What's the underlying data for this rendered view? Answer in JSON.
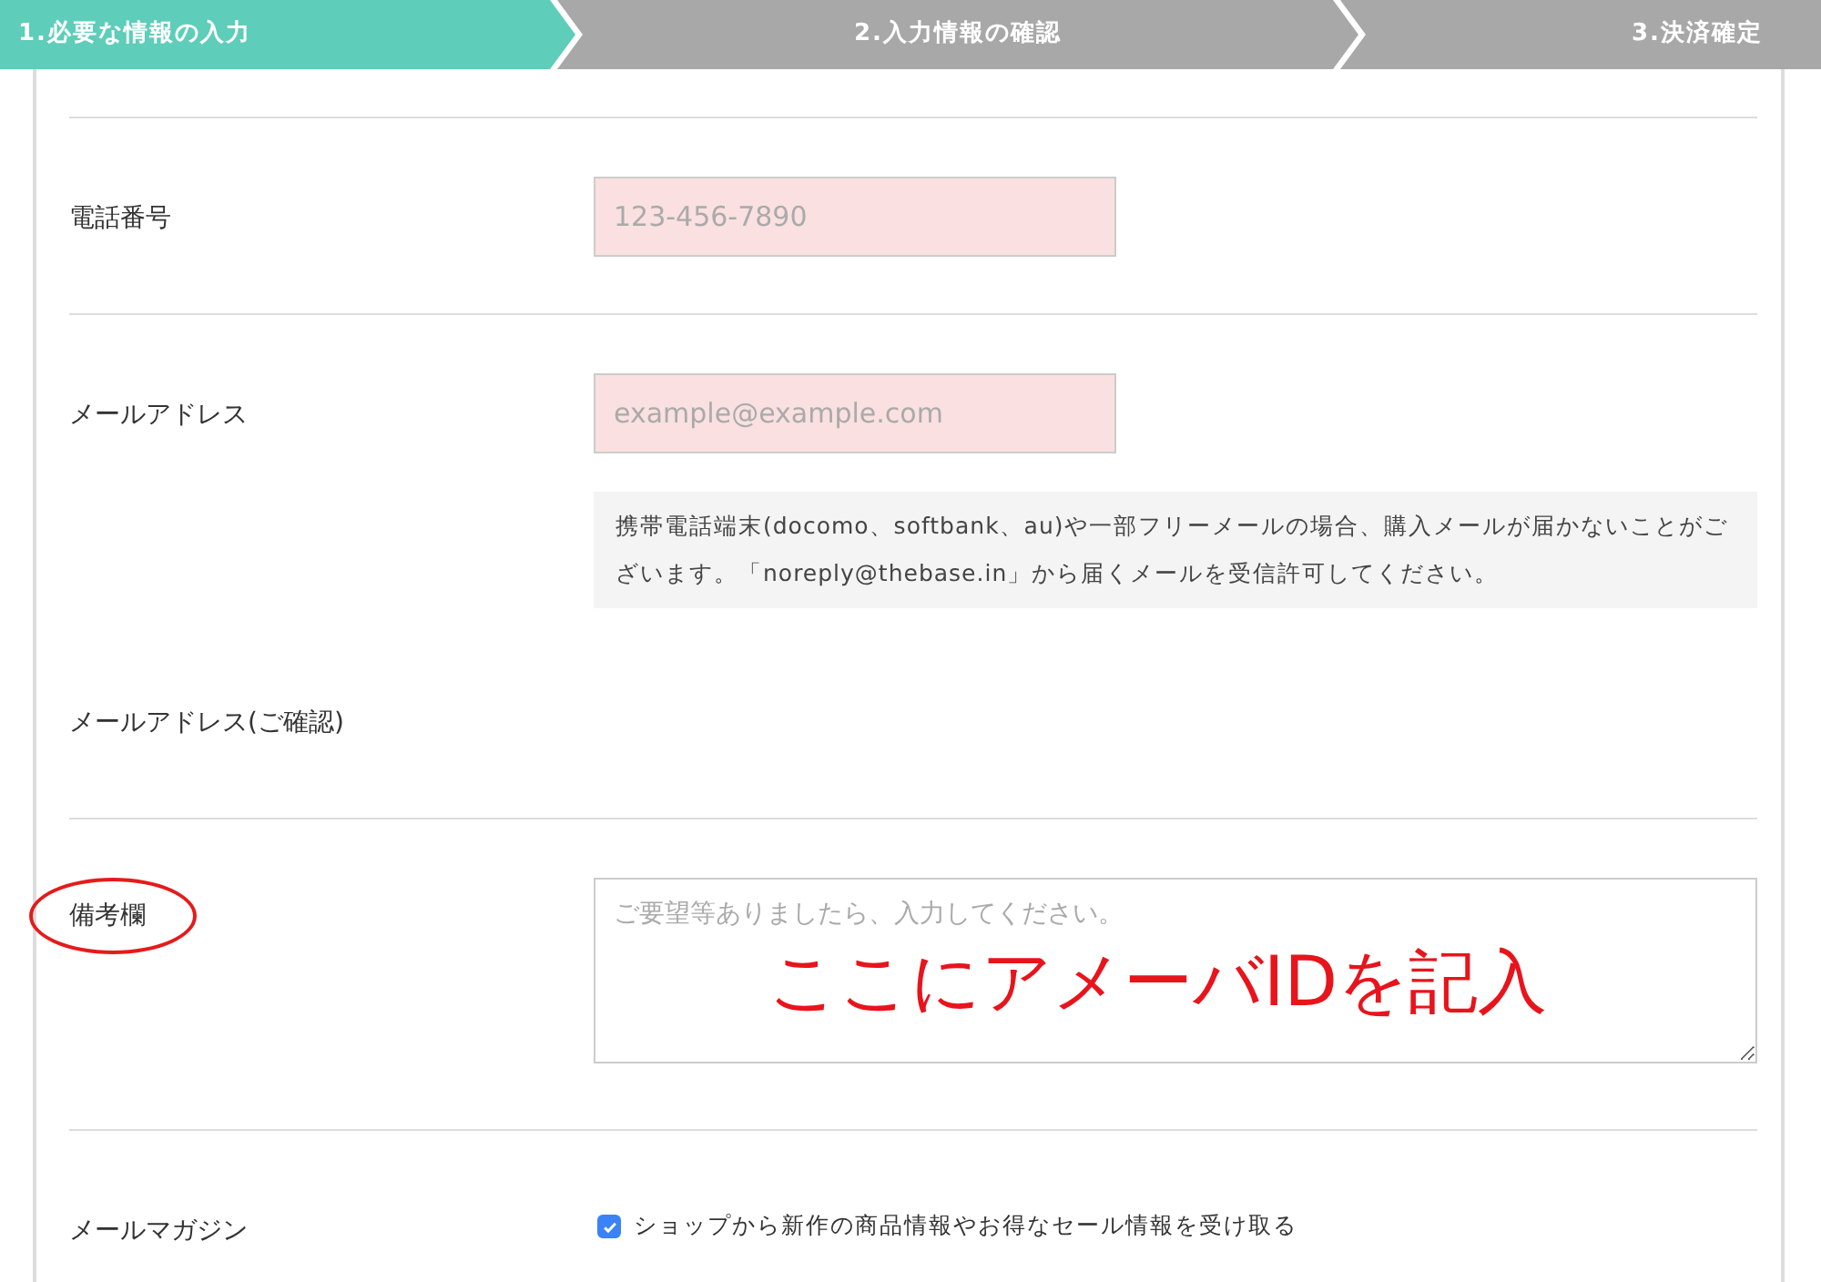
{
  "steps": [
    {
      "label": "1.必要な情報の入力",
      "selected": true
    },
    {
      "label": "2.入力情報の確認",
      "selected": false
    },
    {
      "label": "3.決済確定",
      "selected": false
    }
  ],
  "sections": [
    {
      "kind": "input",
      "label": "電話番号",
      "placeholder": "123-456-7890",
      "error": true
    },
    {
      "kind": "input",
      "label": "メールアドレス",
      "placeholder": "example@example.com",
      "error": true,
      "notice": "携帯電話端末(docomo、softbank、au)や一部フリーメールの場合、購入メールが届かないことがございます。「noreply@thebase.in」から届くメールを受信許可してください。",
      "confirm_label": "メールアドレス(ご確認)"
    },
    {
      "kind": "textarea",
      "label": "備考欄",
      "placeholder": "ご要望等ありましたら、入力してください。",
      "circled": true,
      "annotation": "ここにアメーバIDを記入"
    },
    {
      "kind": "checkbox",
      "label": "メールマガジン",
      "option": "ショップから新作の商品情報やお得なセール情報を受け取る",
      "checked": true
    }
  ]
}
